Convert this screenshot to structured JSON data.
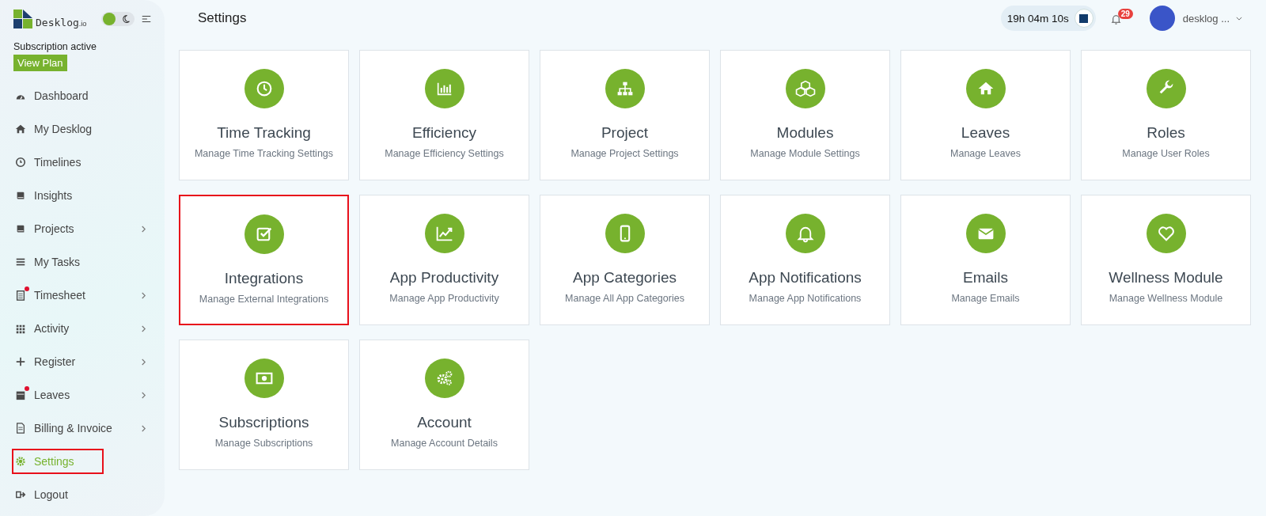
{
  "brand": {
    "name": "Desklog",
    "suffix": ".io"
  },
  "theme_toggle": {
    "on": true
  },
  "subscription": {
    "status": "Subscription active",
    "button": "View Plan"
  },
  "sidebar": {
    "items": [
      {
        "label": "Dashboard",
        "selected": false,
        "has_submenu": false,
        "alert": false,
        "highlighted": false
      },
      {
        "label": "My Desklog",
        "selected": false,
        "has_submenu": false,
        "alert": false,
        "highlighted": false
      },
      {
        "label": "Timelines",
        "selected": false,
        "has_submenu": false,
        "alert": false,
        "highlighted": false
      },
      {
        "label": "Insights",
        "selected": false,
        "has_submenu": false,
        "alert": false,
        "highlighted": false
      },
      {
        "label": "Projects",
        "selected": false,
        "has_submenu": true,
        "alert": false,
        "highlighted": false
      },
      {
        "label": "My Tasks",
        "selected": false,
        "has_submenu": false,
        "alert": false,
        "highlighted": false
      },
      {
        "label": "Timesheet",
        "selected": false,
        "has_submenu": true,
        "alert": true,
        "highlighted": false
      },
      {
        "label": "Activity",
        "selected": false,
        "has_submenu": true,
        "alert": false,
        "highlighted": false
      },
      {
        "label": "Register",
        "selected": false,
        "has_submenu": true,
        "alert": false,
        "highlighted": false
      },
      {
        "label": "Leaves",
        "selected": false,
        "has_submenu": true,
        "alert": true,
        "highlighted": false
      },
      {
        "label": "Billing & Invoice",
        "selected": false,
        "has_submenu": true,
        "alert": false,
        "highlighted": false
      },
      {
        "label": "Settings",
        "selected": true,
        "has_submenu": false,
        "alert": false,
        "highlighted": true
      },
      {
        "label": "Logout",
        "selected": false,
        "has_submenu": false,
        "alert": false,
        "highlighted": false
      }
    ]
  },
  "header": {
    "title": "Settings",
    "timer": "19h 04m 10s",
    "notifications": "29",
    "user": "desklog ..."
  },
  "cards": [
    {
      "title": "Time Tracking",
      "subtitle": "Manage Time Tracking Settings",
      "highlighted": false
    },
    {
      "title": "Efficiency",
      "subtitle": "Manage Efficiency Settings",
      "highlighted": false
    },
    {
      "title": "Project",
      "subtitle": "Manage Project Settings",
      "highlighted": false
    },
    {
      "title": "Modules",
      "subtitle": "Manage Module Settings",
      "highlighted": false
    },
    {
      "title": "Leaves",
      "subtitle": "Manage Leaves",
      "highlighted": false
    },
    {
      "title": "Roles",
      "subtitle": "Manage User Roles",
      "highlighted": false
    },
    {
      "title": "Integrations",
      "subtitle": "Manage External Integrations",
      "highlighted": true
    },
    {
      "title": "App Productivity",
      "subtitle": "Manage App Productivity",
      "highlighted": false
    },
    {
      "title": "App Categories",
      "subtitle": "Manage All App Categories",
      "highlighted": false
    },
    {
      "title": "App Notifications",
      "subtitle": "Manage App Notifications",
      "highlighted": false
    },
    {
      "title": "Emails",
      "subtitle": "Manage Emails",
      "highlighted": false
    },
    {
      "title": "Wellness Module",
      "subtitle": "Manage Wellness Module",
      "highlighted": false
    },
    {
      "title": "Subscriptions",
      "subtitle": "Manage Subscriptions",
      "highlighted": false
    },
    {
      "title": "Account",
      "subtitle": "Manage Account Details",
      "highlighted": false
    }
  ]
}
